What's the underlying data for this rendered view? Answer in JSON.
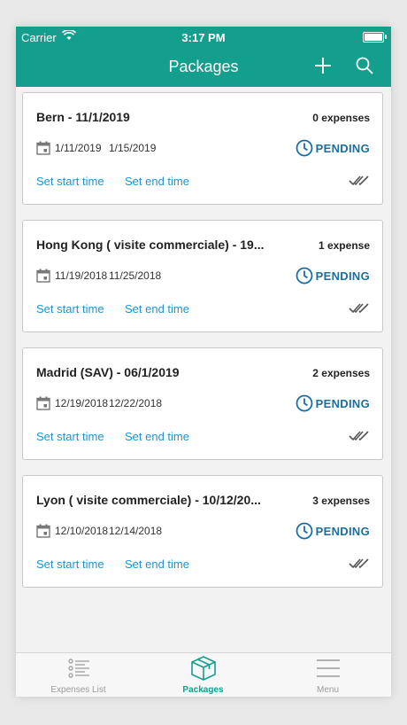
{
  "statusbar": {
    "carrier": "Carrier",
    "time": "3:17 PM"
  },
  "navbar": {
    "title": "Packages",
    "add_icon": "plus-icon",
    "search_icon": "search-icon"
  },
  "packages": [
    {
      "name": "Bern - 11/1/2019",
      "count": "0 expenses",
      "start_date": "1/11/2019",
      "end_date": "1/15/2019",
      "status": "PENDING",
      "set_start": "Set start time",
      "set_end": "Set end time"
    },
    {
      "name": "Hong Kong ( visite commerciale) - 19...",
      "count": "1 expense",
      "start_date": "11/19/2018",
      "end_date": "11/25/2018",
      "status": "PENDING",
      "set_start": "Set start time",
      "set_end": "Set end time"
    },
    {
      "name": "Madrid (SAV) - 06/1/2019",
      "count": "2 expenses",
      "start_date": "12/19/2018",
      "end_date": "12/22/2018",
      "status": "PENDING",
      "set_start": "Set start time",
      "set_end": "Set end time"
    },
    {
      "name": "Lyon ( visite commerciale) - 10/12/20...",
      "count": "3 expenses",
      "start_date": "12/10/2018",
      "end_date": "12/14/2018",
      "status": "PENDING",
      "set_start": "Set start time",
      "set_end": "Set end time"
    }
  ],
  "tabbar": {
    "items": [
      {
        "label": "Expenses List",
        "icon": "list-icon"
      },
      {
        "label": "Packages",
        "icon": "package-icon"
      },
      {
        "label": "Menu",
        "icon": "menu-icon"
      }
    ],
    "active": "Packages"
  },
  "colors": {
    "brand": "#149e8e",
    "link": "#1f93d0",
    "status": "#1a6fa3"
  }
}
